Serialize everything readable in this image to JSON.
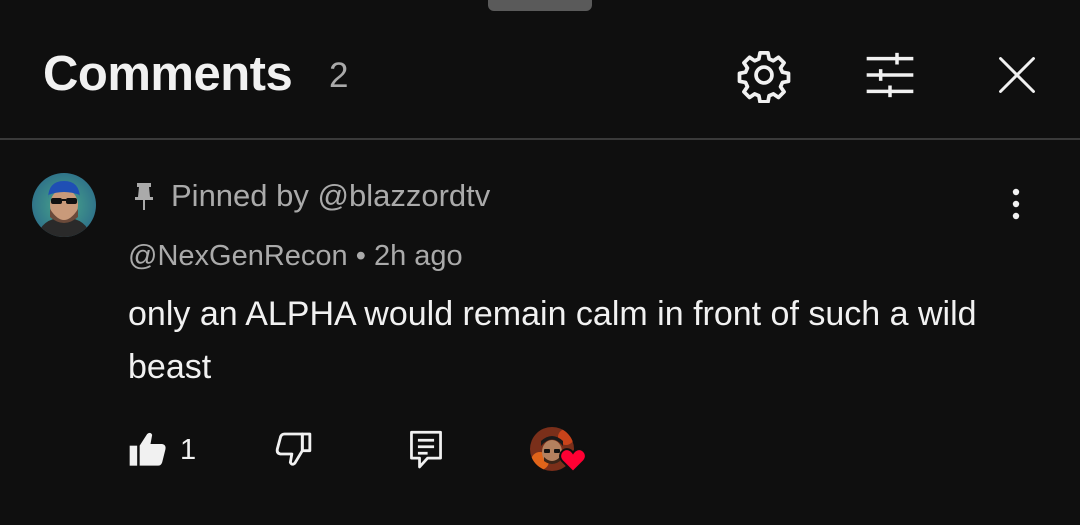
{
  "header": {
    "title": "Comments",
    "count": "2"
  },
  "comment": {
    "pinned_label": "Pinned by @blazzordtv",
    "author": "@NexGenRecon",
    "separator": " • ",
    "time": "2h ago",
    "text": "only an ALPHA would remain calm in front of such a wild beast",
    "like_count": "1"
  },
  "icons": {
    "settings": "gear-icon",
    "filter": "sliders-icon",
    "close": "close-icon",
    "pin": "pin-icon",
    "more": "more-vert-icon",
    "like": "thumbs-up-icon",
    "dislike": "thumbs-down-icon",
    "reply": "reply-icon",
    "creator_heart": "heart-icon"
  },
  "colors": {
    "background": "#0f0f0f",
    "text_primary": "#f1f1f1",
    "text_secondary": "#aaaaaa",
    "heart": "#ff0033"
  }
}
